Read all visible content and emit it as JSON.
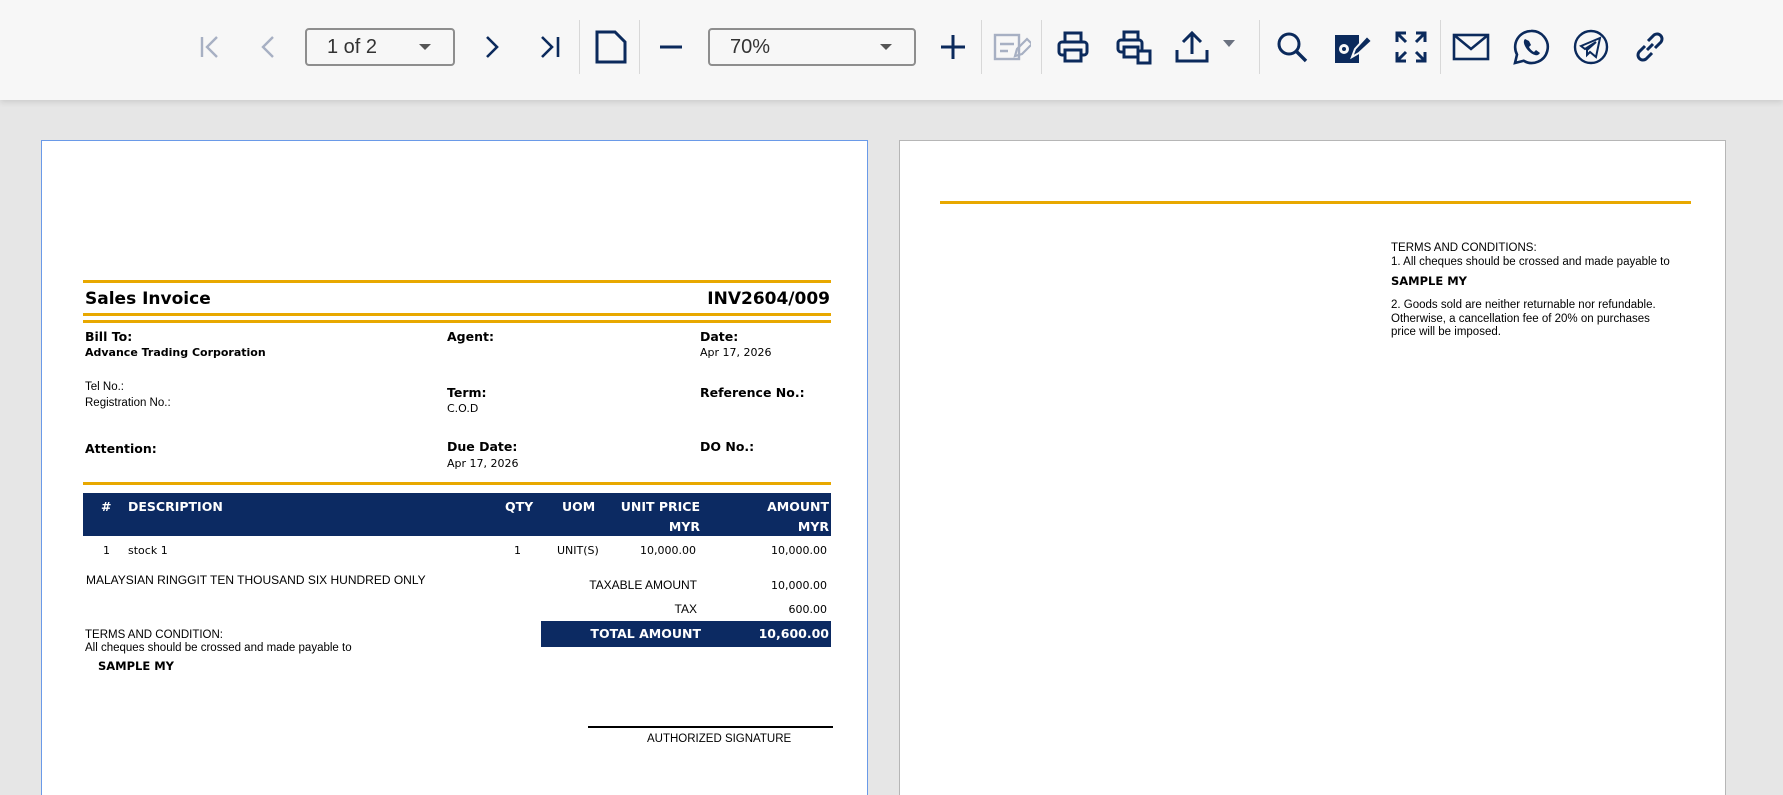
{
  "toolbar": {
    "page_select_value": "1 of 2",
    "zoom_select_value": "70%",
    "icons": [
      "first-page-icon",
      "previous-page-icon",
      "next-page-icon",
      "last-page-icon",
      "page-layout-icon",
      "zoom-out-icon",
      "zoom-in-icon",
      "edit-form-icon",
      "print-icon",
      "print-options-icon",
      "export-icon",
      "search-icon",
      "sign-document-icon",
      "fullscreen-icon",
      "email-icon",
      "whatsapp-icon",
      "telegram-icon",
      "link-icon"
    ]
  },
  "colors": {
    "accent_gold": "#e8a800",
    "navy": "#0c2a62",
    "icon": "#0b2a5c"
  },
  "invoice": {
    "title": "Sales Invoice",
    "number": "INV2604/009",
    "bill_to_label": "Bill To:",
    "bill_to_value": "Advance Trading Corporation",
    "agent_label": "Agent:",
    "date_label": "Date:",
    "date_value": "Apr 17, 2026",
    "tel_label": "Tel No.:",
    "registration_label": "Registration No.:",
    "term_label": "Term:",
    "term_value": "C.O.D",
    "reference_label": "Reference No.:",
    "attention_label": "Attention:",
    "due_date_label": "Due Date:",
    "due_date_value": "Apr 17, 2026",
    "do_label": "DO No.:",
    "columns": {
      "num": "#",
      "description": "DESCRIPTION",
      "qty": "QTY",
      "uom": "UOM",
      "unit_price": "UNIT PRICE",
      "unit_price_currency": "MYR",
      "amount": "AMOUNT",
      "amount_currency": "MYR"
    },
    "rows": [
      {
        "num": "1",
        "description": "stock 1",
        "qty": "1",
        "uom": "UNIT(S)",
        "unit_price": "10,000.00",
        "amount": "10,000.00"
      }
    ],
    "amount_in_words": "MALAYSIAN RINGGIT TEN THOUSAND SIX HUNDRED  ONLY",
    "taxable_label": "TAXABLE AMOUNT",
    "taxable_value": "10,000.00",
    "tax_label": "TAX",
    "tax_value": "600.00",
    "total_label": "TOTAL AMOUNT",
    "total_value": "10,600.00",
    "terms_title": "TERMS AND CONDITION:",
    "terms_line": "All cheques should be crossed and made payable to",
    "terms_payee": "SAMPLE MY",
    "signature_label": "AUTHORIZED SIGNATURE"
  },
  "page2": {
    "terms_title": "TERMS AND CONDITIONS:",
    "term1": "1. All cheques should be crossed and made payable to",
    "payee": "SAMPLE MY",
    "term2_line1": "2. Goods sold are neither returnable nor refundable.",
    "term2_line2": "Otherwise, a cancellation fee of 20% on purchases",
    "term2_line3": "price will be imposed."
  }
}
